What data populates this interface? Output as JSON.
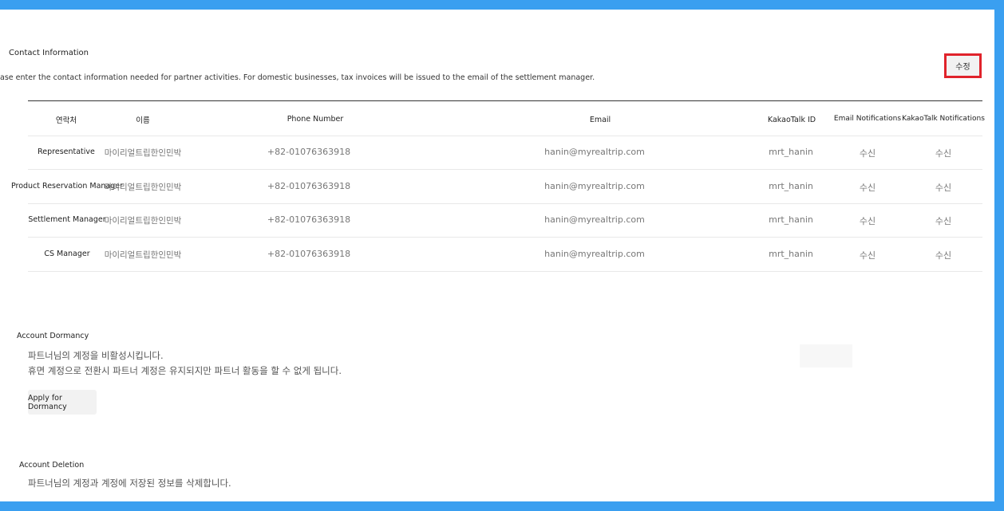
{
  "contact": {
    "title": "Contact Information",
    "description": "ase enter the contact information needed for partner activities. For domestic businesses, tax invoices will be issued to the email of the settlement manager.",
    "edit_label": "수정",
    "headers": {
      "contact": "연락처",
      "name": "이름",
      "phone": "Phone Number",
      "email": "Email",
      "kakao": "KakaoTalk ID",
      "email_notif": "Email Notifications",
      "kakao_notif": "KakaoTalk Notifications"
    },
    "rows": [
      {
        "role": "Representative",
        "name": "마이리얼트립한인민박",
        "phone": "+82-01076363918",
        "email": "hanin@myrealtrip.com",
        "kakao": "mrt_hanin",
        "email_notif": "수신",
        "kakao_notif": "수신"
      },
      {
        "role": "Product Reservation Manager",
        "name": "마이리얼트립한인민박",
        "phone": "+82-01076363918",
        "email": "hanin@myrealtrip.com",
        "kakao": "mrt_hanin",
        "email_notif": "수신",
        "kakao_notif": "수신"
      },
      {
        "role": "Settlement Manager",
        "name": "마이리얼트립한인민박",
        "phone": "+82-01076363918",
        "email": "hanin@myrealtrip.com",
        "kakao": "mrt_hanin",
        "email_notif": "수신",
        "kakao_notif": "수신"
      },
      {
        "role": "CS Manager",
        "name": "마이리얼트립한인민박",
        "phone": "+82-01076363918",
        "email": "hanin@myrealtrip.com",
        "kakao": "mrt_hanin",
        "email_notif": "수신",
        "kakao_notif": "수신"
      }
    ]
  },
  "dormancy": {
    "title": "Account Dormancy",
    "line1": "파트너님의 계정을 비활성시킵니다.",
    "line2": "휴면 계정으로 전환시 파트너 계정은 유지되지만 파트너 활동을 할 수 없게 됩니다.",
    "button": "Apply for Dormancy"
  },
  "deletion": {
    "title": "Account Deletion",
    "line1": "파트너님의 계정과 계정에 저장된 정보를 삭제합니다."
  },
  "colors": {
    "frame": "#3a9ff0",
    "highlight": "#e0232b"
  }
}
